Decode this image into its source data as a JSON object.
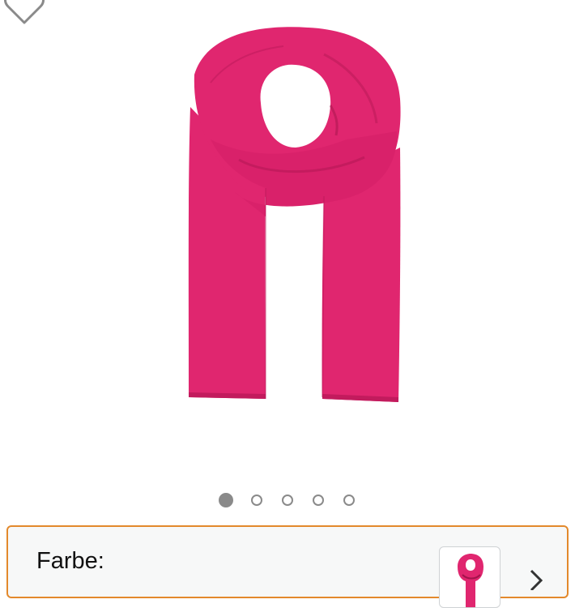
{
  "icons": {
    "wishlist": "heart-outline-icon",
    "chevron": "chevron-right-icon"
  },
  "colors": {
    "product": "#e0266f",
    "product_shadow": "#b51856",
    "panel_border": "#e3892c",
    "dot": "#8a8a8a"
  },
  "carousel": {
    "current": 1,
    "total": 5
  },
  "variant": {
    "label": "Farbe:"
  }
}
